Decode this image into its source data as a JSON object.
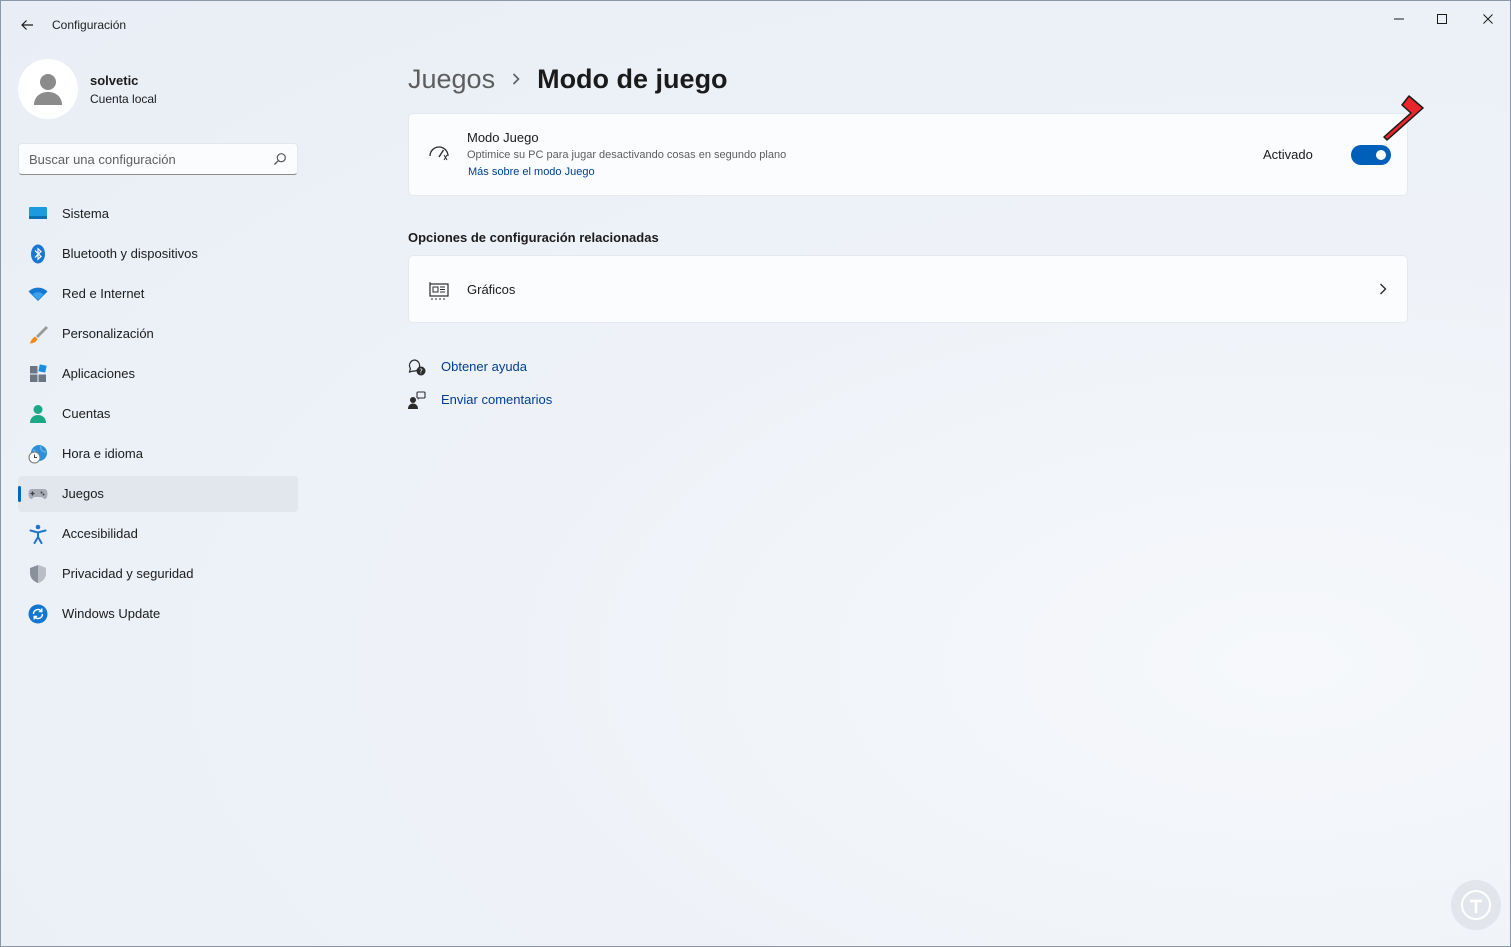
{
  "window": {
    "title": "Configuración",
    "controls": {
      "minimize": "minimize-icon",
      "maximize": "maximize-icon",
      "close": "close-icon"
    }
  },
  "profile": {
    "name": "solvetic",
    "account_type": "Cuenta local"
  },
  "search": {
    "placeholder": "Buscar una configuración"
  },
  "sidebar": {
    "items": [
      {
        "label": "Sistema",
        "icon": "system-icon"
      },
      {
        "label": "Bluetooth y dispositivos",
        "icon": "bluetooth-icon"
      },
      {
        "label": "Red e Internet",
        "icon": "wifi-icon"
      },
      {
        "label": "Personalización",
        "icon": "brush-icon"
      },
      {
        "label": "Aplicaciones",
        "icon": "apps-icon"
      },
      {
        "label": "Cuentas",
        "icon": "account-icon"
      },
      {
        "label": "Hora e idioma",
        "icon": "clock-globe-icon"
      },
      {
        "label": "Juegos",
        "icon": "gamepad-icon",
        "selected": true
      },
      {
        "label": "Accesibilidad",
        "icon": "accessibility-icon"
      },
      {
        "label": "Privacidad y seguridad",
        "icon": "shield-icon"
      },
      {
        "label": "Windows Update",
        "icon": "update-icon"
      }
    ]
  },
  "breadcrumb": {
    "parent": "Juegos",
    "current": "Modo de juego"
  },
  "game_mode": {
    "title": "Modo Juego",
    "description": "Optimice su PC para jugar desactivando cosas en segundo plano",
    "link": "Más sobre el modo Juego",
    "state_label": "Activado",
    "enabled": true
  },
  "related": {
    "title": "Opciones de configuración relacionadas",
    "graphics_label": "Gráficos"
  },
  "help": {
    "get_help": "Obtener ayuda",
    "feedback": "Enviar comentarios"
  },
  "colors": {
    "accent": "#005fb8",
    "link": "#003e92",
    "annotation_arrow": "#e8262b"
  }
}
